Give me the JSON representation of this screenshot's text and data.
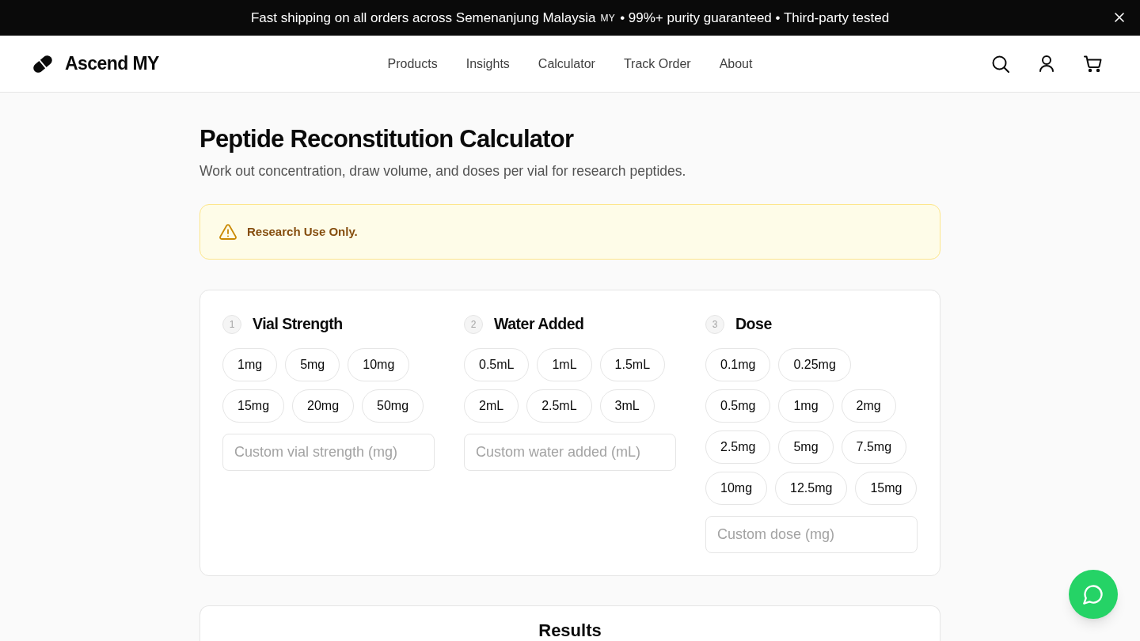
{
  "announcement": {
    "parts": [
      {
        "kind": "text",
        "text": "Fast shipping on all orders across Semenanjung Malaysia"
      },
      {
        "kind": "flag",
        "text": "MY"
      },
      {
        "kind": "text",
        "text": "• 99%+ purity guaranteed • Third-party tested"
      }
    ]
  },
  "header": {
    "brand": "Ascend MY",
    "nav": [
      "Products",
      "Insights",
      "Calculator",
      "Track Order",
      "About"
    ]
  },
  "page": {
    "title": "Peptide Reconstitution Calculator",
    "subtitle": "Work out concentration, draw volume, and doses per vial for research peptides."
  },
  "notice": {
    "text": "Research Use Only."
  },
  "steps": [
    {
      "number": "1",
      "title": "Vial Strength",
      "option_rows": [
        [
          {
            "label": "1mg",
            "selected": false
          },
          {
            "label": "5mg",
            "selected": false
          },
          {
            "label": "10mg",
            "selected": false
          }
        ],
        [
          {
            "label": "15mg",
            "selected": false
          },
          {
            "label": "20mg",
            "selected": false
          },
          {
            "label": "50mg",
            "selected": false
          }
        ]
      ],
      "custom": {
        "placeholder": "Custom vial strength (mg)"
      }
    },
    {
      "number": "2",
      "title": "Water Added",
      "option_rows": [
        [
          {
            "label": "0.5mL",
            "selected": false
          },
          {
            "label": "1mL",
            "selected": false
          },
          {
            "label": "1.5mL",
            "selected": false
          }
        ],
        [
          {
            "label": "2mL",
            "selected": false
          },
          {
            "label": "2.5mL",
            "selected": false
          },
          {
            "label": "3mL",
            "selected": false
          }
        ]
      ],
      "custom": {
        "placeholder": "Custom water added (mL)"
      }
    },
    {
      "number": "3",
      "title": "Dose",
      "option_rows": [
        [
          {
            "label": "0.1mg",
            "selected": false
          },
          {
            "label": "0.25mg",
            "selected": false
          }
        ],
        [
          {
            "label": "0.5mg",
            "selected": false
          },
          {
            "label": "1mg",
            "selected": false
          },
          {
            "label": "2mg",
            "selected": false
          }
        ],
        [
          {
            "label": "2.5mg",
            "selected": false
          },
          {
            "label": "5mg",
            "selected": false
          },
          {
            "label": "7.5mg",
            "selected": false
          }
        ],
        [
          {
            "label": "10mg",
            "selected": false
          },
          {
            "label": "12.5mg",
            "selected": false
          },
          {
            "label": "15mg",
            "selected": false
          }
        ]
      ],
      "custom": {
        "placeholder": "Custom dose (mg)"
      }
    }
  ],
  "results": {
    "title": "Results"
  }
}
